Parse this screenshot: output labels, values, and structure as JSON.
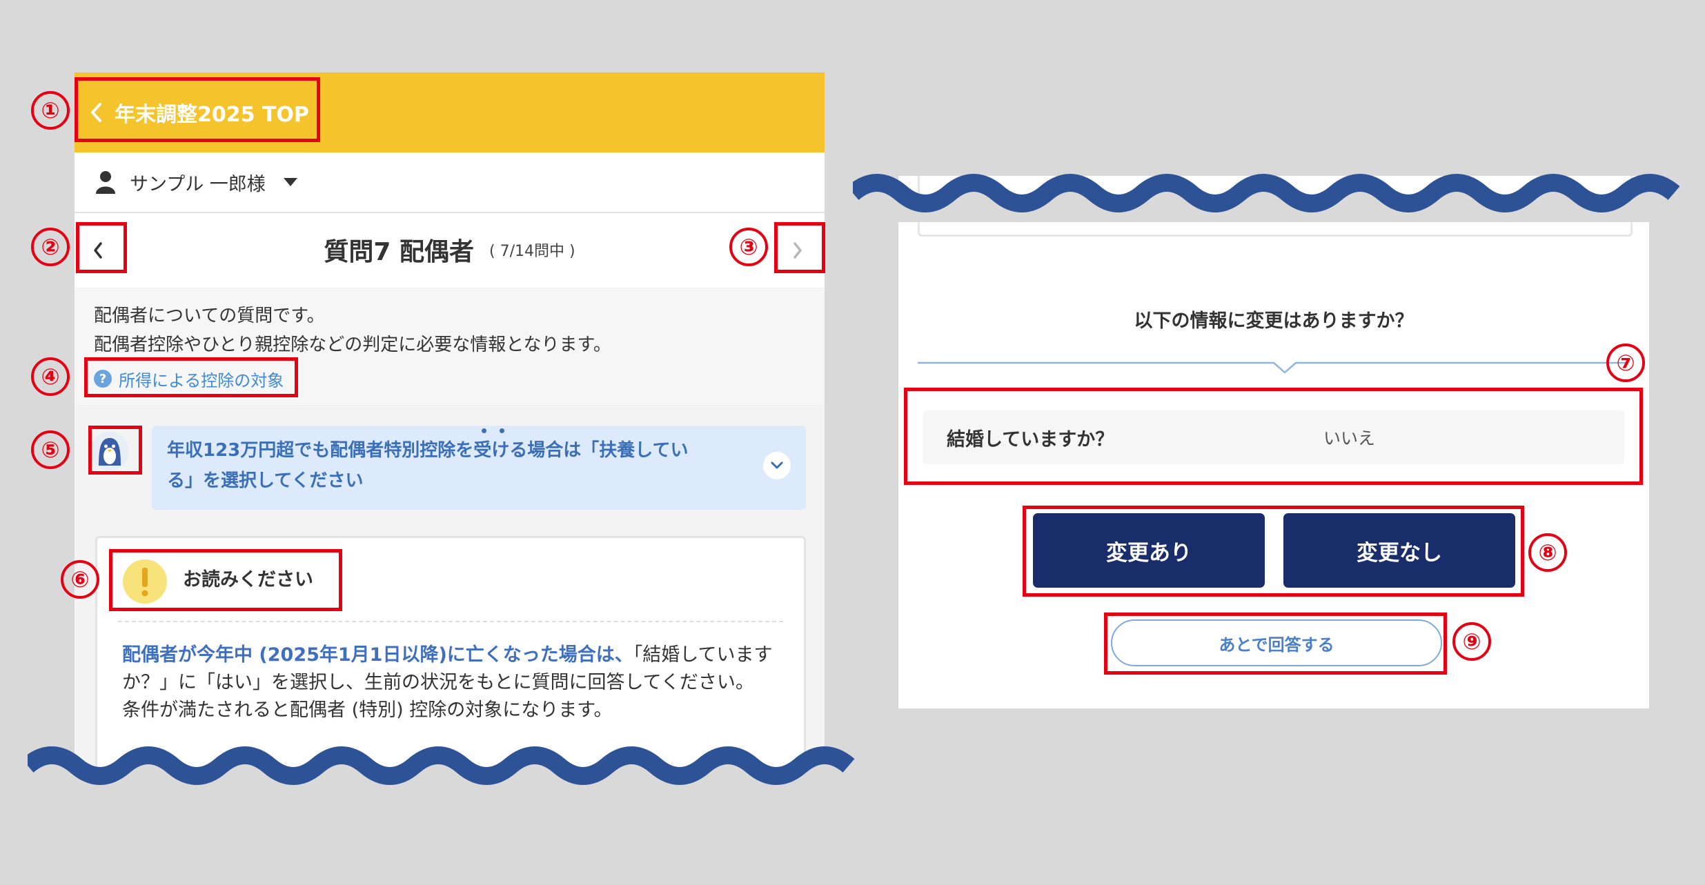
{
  "left_screen": {
    "header": {
      "top_link_label": "年末調整2025 TOP"
    },
    "user": {
      "name": "サンプル 一郎様"
    },
    "question_nav": {
      "title": "質問7 配偶者",
      "count": "( 7/14問中 )"
    },
    "intro": {
      "line1": "配偶者についての質問です。",
      "line2": "配偶者控除やひとり親控除などの判定に必要な情報となります。",
      "deduction_link": "所得による控除の対象"
    },
    "advice": {
      "line1": "年収123万円超でも配偶者特別控除を受ける場合は「扶養してい",
      "line2": "る」を選択してください"
    },
    "notice": {
      "title": "お読みください",
      "body_emphasis": "配偶者が今年中 (2025年1月1日以降)に亡くなった場合は、",
      "body_rest1": "「結婚しています",
      "body_line2": "か？」に「はい」を選択し、生前の状況をもとに質問に回答してください。",
      "body_line3": "条件が満たされると配偶者 (特別) 控除の対象になります。"
    }
  },
  "right_screen": {
    "change_question": "以下の情報に変更はありますか？",
    "marriage": {
      "label": "結婚していますか？",
      "value": "いいえ"
    },
    "buttons": {
      "changed": "変更あり",
      "no_change": "変更なし",
      "answer_later": "あとで回答する"
    }
  },
  "annotations": [
    "①",
    "②",
    "③",
    "④",
    "⑤",
    "⑥",
    "⑦",
    "⑧",
    "⑨"
  ],
  "colors": {
    "header": "#f5c32c",
    "primary_button": "#1a2d6b",
    "annotation": "#e50012",
    "wave": "#2d5296",
    "advice_bg": "#ddeafc"
  }
}
